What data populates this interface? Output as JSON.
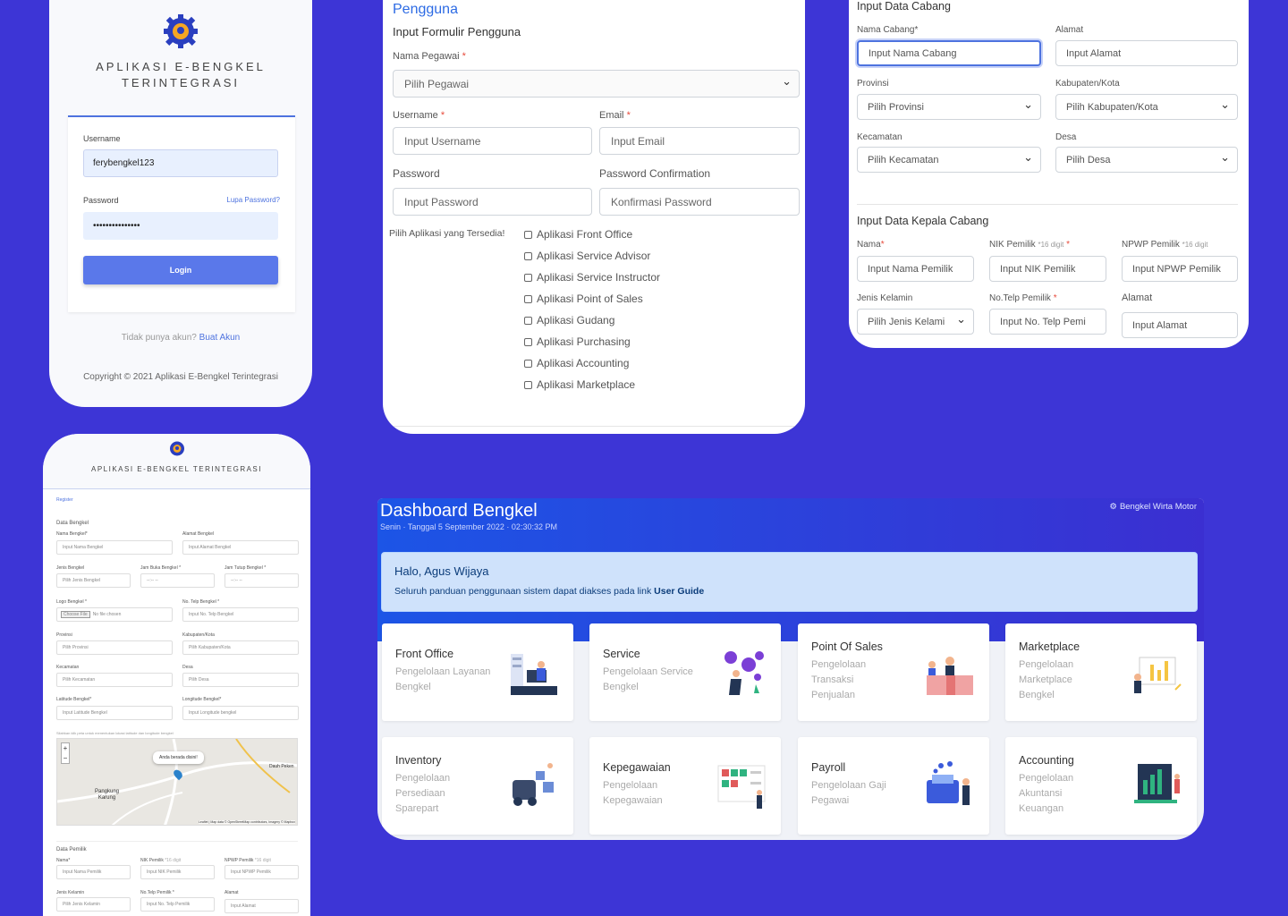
{
  "login": {
    "title_line1": "APLIKASI E-BENGKEL",
    "title_line2": "TERINTEGRASI",
    "username_label": "Username",
    "username_value": "ferybengkel123",
    "password_label": "Password",
    "password_value": "•••••••••••••••",
    "forgot_link": "Lupa Password?",
    "login_button": "Login",
    "no_account_text": "Tidak punya akun?",
    "create_account_link": "Buat Akun",
    "copyright": "Copyright © 2021 Aplikasi E-Bengkel Terintegrasi"
  },
  "register": {
    "title": "APLIKASI E-BENGKEL TERINTEGRASI",
    "tab": "Register",
    "section_bengkel": "Data Bengkel",
    "nama_bengkel_label": "Nama Bengkel*",
    "nama_bengkel_ph": "Input Nama Bengkel",
    "alamat_bengkel_label": "Alamat Bengkel",
    "alamat_bengkel_ph": "Input Alamat Bengkel",
    "jenis_label": "Jenis Bengkel",
    "jenis_ph": "Pilih Jenis Bengkel",
    "jam_buka_label": "Jam Buka Bengkel *",
    "jam_tutup_label": "Jam Tutup Bengkel *",
    "time_ph": "--:-- --",
    "logo_label": "Logo Bengkel *",
    "choose_file": "Choose File",
    "no_file": "No file chosen",
    "telp_label": "No. Telp Bengkel *",
    "telp_ph": "Input No. Telp Bengkel",
    "provinsi_label": "Provinsi",
    "provinsi_ph": "Pilih Provinsi",
    "kabupaten_label": "Kabupaten/Kota",
    "kabupaten_ph": "Pilih Kabupaten/Kota",
    "kecamatan_label": "Kecamatan",
    "kecamatan_ph": "Pilih Kecamatan",
    "desa_label": "Desa",
    "desa_ph": "Pilih Desa",
    "lat_label": "Latitude Bengkel*",
    "lat_ph": "Input Latitude Bengkel",
    "long_label": "Longitude Bengkel*",
    "long_ph": "Input Longitude bengkel",
    "map_hint": "Silahkan klik peta untuk menentukan lokasi latitude dan longitude bengkel",
    "map_popup": "Anda berada disini!",
    "map_place1": "Pangkung",
    "map_place1b": "Karung",
    "map_place2": "Dauh Peken",
    "map_attr": "Leaflet | Map data © OpenStreetMap contributors, Imagery © Mapbox",
    "zoom_in": "+",
    "zoom_out": "−",
    "section_pemilik": "Data Pemilik",
    "nama_label": "Nama*",
    "nama_ph": "Input Nama Pemilik",
    "nik_label": "NIK Pemilik",
    "nik_hint": "*16 digit",
    "nik_ph": "Input NIK Pemilik",
    "npwp_label": "NPWP Pemilik",
    "npwp_hint": "*16 digit",
    "npwp_ph": "Input NPWP Pemilik",
    "jk_label": "Jenis Kelamin",
    "jk_ph": "Pilih Jenis Kelamin",
    "telp_pemilik_label": "No.Telp Pemilik *",
    "telp_pemilik_ph": "Input No. Telp Pemilik",
    "alamat_label": "Alamat",
    "alamat_ph": "Input Alamat"
  },
  "userform": {
    "heading": "Pengguna",
    "subheading": "Input Formulir Pengguna",
    "pegawai_label": "Nama Pegawai",
    "pegawai_ph": "Pilih Pegawai",
    "username_label": "Username",
    "username_ph": "Input Username",
    "email_label": "Email",
    "email_ph": "Input Email",
    "password_label": "Password",
    "password_ph": "Input Password",
    "confirm_label": "Password Confirmation",
    "confirm_ph": "Konfirmasi Password",
    "apps_label": "Pilih Aplikasi yang Tersedia!",
    "apps": [
      "Aplikasi Front Office",
      "Aplikasi Service Advisor",
      "Aplikasi Service Instructor",
      "Aplikasi Point of Sales",
      "Aplikasi Gudang",
      "Aplikasi Purchasing",
      "Aplikasi Accounting",
      "Aplikasi Marketplace"
    ]
  },
  "branch": {
    "heading": "Input Data Cabang",
    "nama_label": "Nama Cabang*",
    "nama_ph": "Input Nama Cabang",
    "alamat_label": "Alamat",
    "alamat_ph": "Input Alamat",
    "provinsi_label": "Provinsi",
    "provinsi_ph": "Pilih Provinsi",
    "kabupaten_label": "Kabupaten/Kota",
    "kabupaten_ph": "Pilih Kabupaten/Kota",
    "kecamatan_label": "Kecamatan",
    "kecamatan_ph": "Pilih Kecamatan",
    "desa_label": "Desa",
    "desa_ph": "Pilih Desa",
    "kepala_heading": "Input Data Kepala Cabang",
    "nama_kepala_label": "Nama",
    "nama_kepala_ph": "Input Nama Pemilik",
    "nik_label": "NIK Pemilik",
    "nik_hint": "*16 digit",
    "nik_ph": "Input NIK Pemilik",
    "npwp_label": "NPWP Pemilik",
    "npwp_hint": "*16 digit",
    "npwp_ph": "Input NPWP Pemilik",
    "jk_label": "Jenis Kelamin",
    "jk_ph": "Pilih Jenis Kelami",
    "telp_label": "No.Telp Pemilik",
    "telp_ph": "Input No. Telp Pemi"
  },
  "dashboard": {
    "title": "Dashboard Bengkel",
    "subtitle": "Senin · Tanggal 5 September 2022 · 02:30:32 PM",
    "workshop_name": "Bengkel Wirta Motor",
    "greeting": "Halo, Agus Wijaya",
    "guide_text": "Seluruh panduan penggunaan sistem dapat diakses pada link",
    "guide_link": "User Guide",
    "tiles": [
      {
        "title": "Front Office",
        "desc1": "Pengelolaan Layanan",
        "desc2": "Bengkel",
        "desc3": ""
      },
      {
        "title": "Service",
        "desc1": "Pengelolaan Service",
        "desc2": "Bengkel",
        "desc3": ""
      },
      {
        "title": "Point Of Sales",
        "desc1": "Pengelolaan",
        "desc2": "Transaksi",
        "desc3": "Penjualan"
      },
      {
        "title": "Marketplace",
        "desc1": "Pengelolaan",
        "desc2": "Marketplace",
        "desc3": "Bengkel"
      },
      {
        "title": "Inventory",
        "desc1": "Pengelolaan",
        "desc2": "Persediaan",
        "desc3": "Sparepart"
      },
      {
        "title": "Kepegawaian",
        "desc1": "Pengelolaan",
        "desc2": "Kepegawaian",
        "desc3": ""
      },
      {
        "title": "Payroll",
        "desc1": "Pengelolaan Gaji",
        "desc2": "Pegawai",
        "desc3": ""
      },
      {
        "title": "Accounting",
        "desc1": "Pengelolaan",
        "desc2": "Akuntansi",
        "desc3": "Keuangan"
      }
    ]
  },
  "colors": {
    "background": "#3d35d6",
    "primary": "#4e73df",
    "accent_gear": "#f5a623"
  }
}
